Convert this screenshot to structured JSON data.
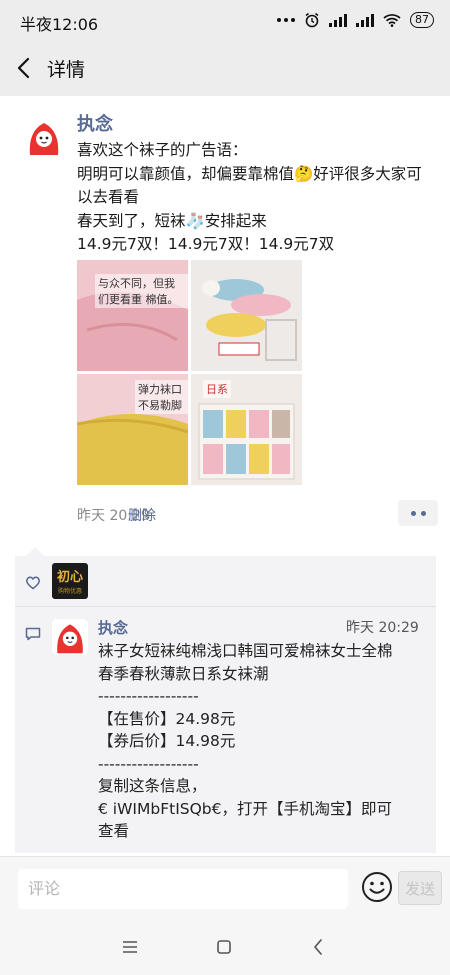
{
  "status_bar": {
    "time": "半夜12:06",
    "battery": "87"
  },
  "nav": {
    "title": "详情"
  },
  "post": {
    "author": "执念",
    "lines": [
      "喜欢这个袜子的广告语：",
      "明明可以靠颜值，却偏要靠棉值🤔好评很多大家可",
      "以去看看",
      "春天到了，短袜🧦安排起来",
      "14.9元7双！14.9元7双！14.9元7双"
    ],
    "photos": [
      {
        "caption": "与众不同，但我们更看重 棉值。",
        "color": "#ecbcc4"
      },
      {
        "caption": "",
        "color": "#e9e4e1"
      },
      {
        "caption": "弹力袜口 不易勒脚",
        "color": "#e3c64f"
      },
      {
        "caption": "日系",
        "color": "#efe6e2"
      }
    ],
    "time": "昨天 20:29",
    "delete": "删除"
  },
  "likes": {
    "avatar_text": "初心",
    "avatar_subtext": "购物优惠"
  },
  "comment": {
    "author": "执念",
    "time": "昨天 20:29",
    "lines": [
      "袜子女短袜纯棉浅口韩国可爱棉袜女士全棉",
      "春季春秋薄款日系女袜潮",
      "------------------",
      "【在售价】24.98元",
      "【券后价】14.98元",
      "------------------",
      "复制这条信息，",
      "€ iWIMbFtISQb€，打开【手机淘宝】即可",
      "查看"
    ]
  },
  "input_bar": {
    "placeholder": "评论",
    "send": "发送"
  },
  "colors": {
    "link": "#576b95",
    "avatar_red": "#e8332f"
  }
}
